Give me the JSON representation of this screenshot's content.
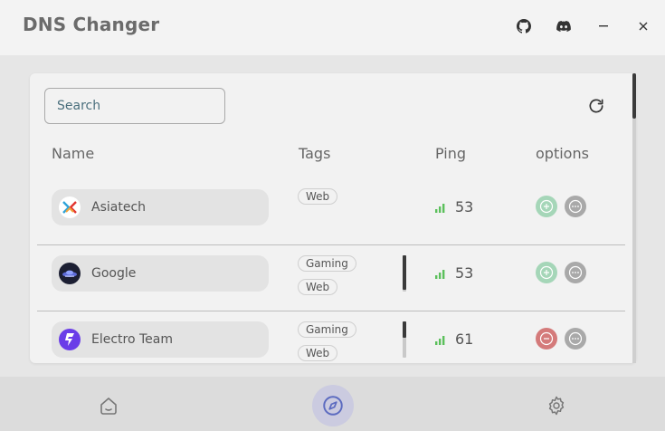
{
  "window": {
    "title": "DNS Changer",
    "controls": {
      "minimize": "–",
      "close": "×"
    }
  },
  "search": {
    "placeholder": "Search",
    "value": ""
  },
  "table": {
    "headers": {
      "name": "Name",
      "tags": "Tags",
      "ping": "Ping",
      "options": "options"
    },
    "rows": [
      {
        "name": "Asiatech",
        "tags": [
          "Web"
        ],
        "ping": "53",
        "action": "add"
      },
      {
        "name": "Google",
        "tags": [
          "Gaming",
          "Web"
        ],
        "ping": "53",
        "action": "add"
      },
      {
        "name": "Electro Team",
        "tags": [
          "Gaming",
          "Web"
        ],
        "ping": "61",
        "action": "remove"
      }
    ]
  },
  "icons": {
    "titlebar": [
      "github-icon",
      "discord-icon",
      "minimize-icon",
      "close-icon"
    ],
    "toolbar": [
      "refresh-icon"
    ],
    "bottom_nav": [
      "home-icon",
      "compass-icon",
      "settings-icon"
    ]
  },
  "colors": {
    "accent": "#5c6bc0",
    "ping_good": "#5cc05c",
    "add_button": "#a5d6b8",
    "remove_button": "#d47a7a",
    "more_button": "#a9a9a9"
  },
  "navigation": {
    "active": "explore"
  }
}
